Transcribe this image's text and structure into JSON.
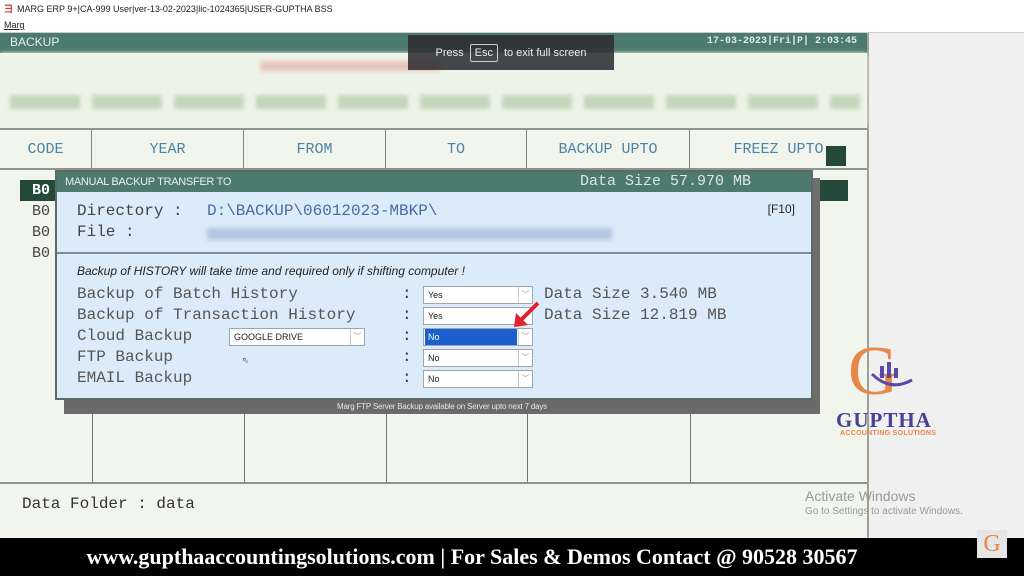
{
  "window": {
    "title": "MARG ERP 9+|CA-999 User|ver-13-02-2023|lic-1024365|USER-GUPTHA BSS",
    "menu": "Marg"
  },
  "app": {
    "header_title": "BACKUP",
    "datetime": "17-03-2023|Fri|P| 2:03:45"
  },
  "fullscreen_toast": {
    "press": "Press",
    "key": "Esc",
    "rest": "to exit full screen"
  },
  "grid": {
    "columns": [
      "CODE",
      "YEAR",
      "FROM",
      "TO",
      "BACKUP UPTO",
      "FREEZ UPTO"
    ],
    "rows": [
      "B0",
      "B0",
      "B0",
      "B0"
    ]
  },
  "dialog": {
    "title": "MANUAL BACKUP TRANSFER TO",
    "data_size": "Data Size 57.970 MB",
    "directory_label": "Directory :",
    "directory_value": "D:\\BACKUP\\06012023-MBKP\\",
    "file_label": "File      :",
    "f10": "[F10]",
    "note": "Backup of HISTORY will take time and required only if shifting computer !",
    "options": [
      {
        "label": "Backup of Batch History",
        "value": "Yes",
        "size": "Data Size 3.540 MB"
      },
      {
        "label": "Backup of Transaction History",
        "value": "Yes",
        "size": "Data Size 12.819 MB"
      },
      {
        "label": "Cloud Backup",
        "value": "No",
        "provider": "GOOGLE DRIVE"
      },
      {
        "label": "FTP   Backup",
        "value": "No"
      },
      {
        "label": "EMAIL Backup",
        "value": "No"
      }
    ],
    "colon": ":",
    "footer": "Marg FTP Server Backup available on Server upto next 7 days"
  },
  "status": {
    "data_folder": "Data Folder : data"
  },
  "brand": {
    "initial": "G",
    "name": "GUPTHA",
    "tagline": "ACCOUNTING SOLUTIONS"
  },
  "windows_watermark": {
    "line1": "Activate Windows",
    "line2": "Go to Settings to activate Windows."
  },
  "promo": {
    "text": "www.gupthaaccountingsolutions.com | For Sales & Demos Contact @ 90528 30567"
  },
  "colors": {
    "header_green": "#4d7a6e",
    "selected_row": "#24493b",
    "dialog_bg": "#dcebfa",
    "dropdown_active": "#1b5fcf",
    "arrow_red": "#e0202a"
  }
}
